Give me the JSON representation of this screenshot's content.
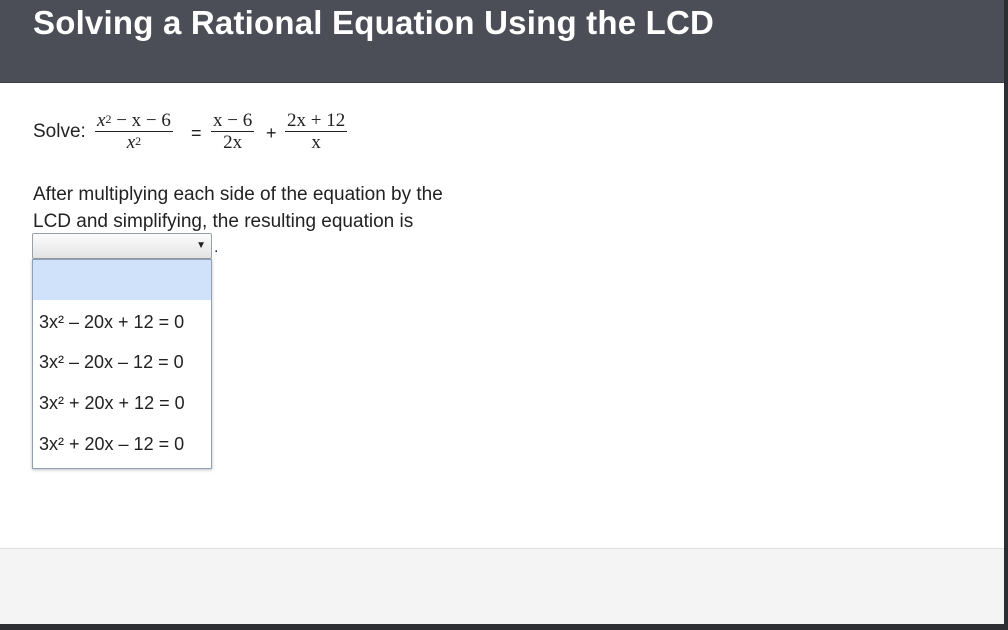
{
  "header": {
    "title": "Solving a Rational Equation Using the LCD"
  },
  "problem": {
    "solve_label": "Solve:",
    "frac1": {
      "num_a": "x",
      "num_sup": "2",
      "num_b": " − x − 6",
      "den_a": "x",
      "den_sup": "2"
    },
    "equals": "=",
    "frac2": {
      "num": "x − 6",
      "den": "2x"
    },
    "plus": "+",
    "frac3": {
      "num": "2x + 12",
      "den": "x"
    }
  },
  "instruction": {
    "text": "After multiplying each side of the equation by the LCD and simplifying, the resulting equation is",
    "period": "."
  },
  "select": {
    "selected": "",
    "arrow": "▼",
    "options": [
      "",
      "3x² – 20x + 12 = 0",
      "3x² – 20x – 12 = 0",
      "3x² + 20x + 12 = 0",
      "3x² + 20x – 12 = 0"
    ]
  },
  "colors": {
    "header_bg": "#4b4e57",
    "highlight": "#cfe2fa"
  }
}
